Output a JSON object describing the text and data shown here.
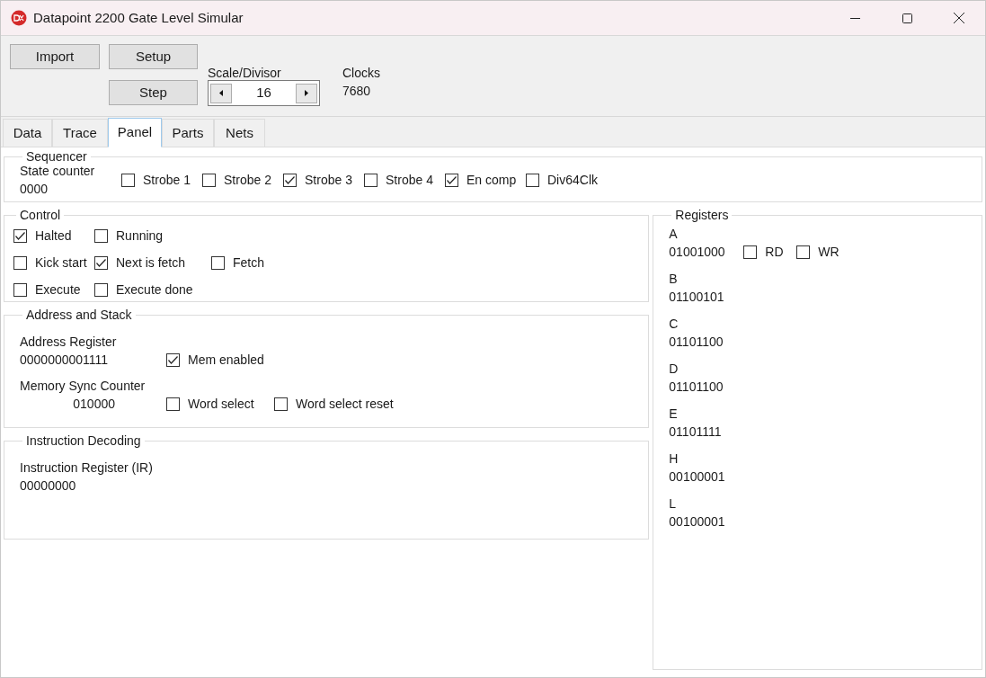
{
  "window": {
    "title": "Datapoint 2200 Gate Level Simular"
  },
  "toolbar": {
    "buttons": [
      "Import",
      "Setup",
      "Step"
    ],
    "scale": {
      "label": "Scale/Divisor",
      "value": "16"
    },
    "clocks": {
      "label": "Clocks",
      "value": "7680"
    }
  },
  "tabs": [
    {
      "label": "Data",
      "selected": false
    },
    {
      "label": "Trace",
      "selected": false
    },
    {
      "label": "Panel",
      "selected": true
    },
    {
      "label": "Parts",
      "selected": false
    },
    {
      "label": "Nets",
      "selected": false
    }
  ],
  "sequencer": {
    "title": "Sequencer",
    "state_counter": {
      "label": "State counter",
      "value": "0000"
    },
    "checkboxes": [
      {
        "label": "Strobe 1",
        "checked": false
      },
      {
        "label": "Strobe 2",
        "checked": false
      },
      {
        "label": "Strobe 3",
        "checked": true
      },
      {
        "label": "Strobe 4",
        "checked": false
      },
      {
        "label": "En comp",
        "checked": true
      },
      {
        "label": "Div64Clk",
        "checked": false
      }
    ]
  },
  "control": {
    "title": "Control",
    "rows": [
      [
        {
          "label": "Halted",
          "checked": true
        },
        {
          "label": "Running",
          "checked": false
        }
      ],
      [
        {
          "label": "Kick start",
          "checked": false
        },
        {
          "label": "Next is fetch",
          "checked": true
        },
        {
          "label": "Fetch",
          "checked": false
        }
      ],
      [
        {
          "label": "Execute",
          "checked": false
        },
        {
          "label": "Execute done",
          "checked": false
        }
      ]
    ]
  },
  "address_and_stack": {
    "title": "Address and Stack",
    "rows": [
      {
        "label": "Address Register",
        "value": "0000000001111",
        "checkboxes": [
          {
            "label": "Mem enabled",
            "checked": true
          }
        ]
      },
      {
        "label": "Memory Sync Counter",
        "value": "010000",
        "checkboxes": [
          {
            "label": "Word select",
            "checked": false
          },
          {
            "label": "Word select reset",
            "checked": false
          }
        ]
      }
    ]
  },
  "instruction_decoding": {
    "title": "Instruction Decoding",
    "instruction_register": {
      "label": "Instruction Register (IR)",
      "value": "00000000"
    }
  },
  "registers": {
    "title": "Registers",
    "items": [
      {
        "name": "A",
        "value": "01001000",
        "checkboxes": [
          {
            "label": "RD",
            "checked": false
          },
          {
            "label": "WR",
            "checked": false
          }
        ]
      },
      {
        "name": "B",
        "value": "01100101"
      },
      {
        "name": "C",
        "value": "01101100"
      },
      {
        "name": "D",
        "value": "01101100"
      },
      {
        "name": "E",
        "value": "01101111"
      },
      {
        "name": "H",
        "value": "00100001"
      },
      {
        "name": "L",
        "value": "00100001"
      }
    ]
  }
}
